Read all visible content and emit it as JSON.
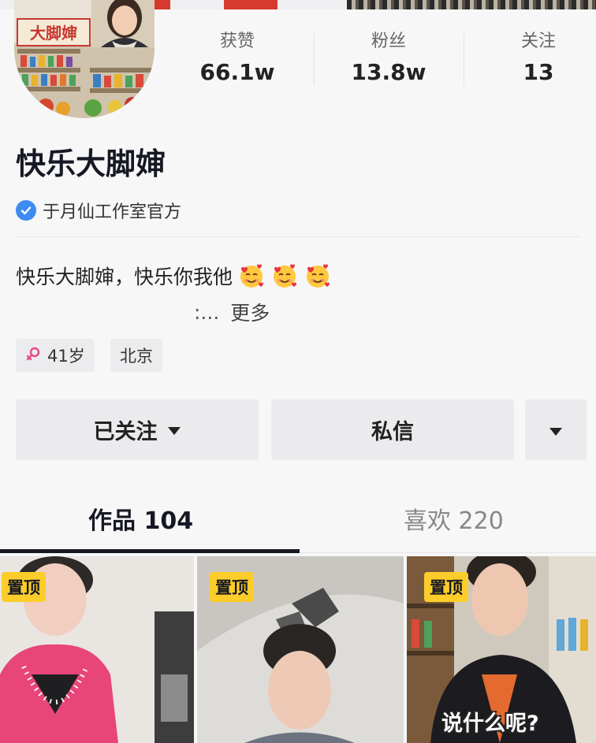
{
  "profile": {
    "name": "快乐大脚婶",
    "avatar_text": "大脚婶",
    "verification": "于月仙工作室官方",
    "stats": [
      {
        "label": "获赞",
        "value": "66.1w"
      },
      {
        "label": "粉丝",
        "value": "13.8w"
      },
      {
        "label": "关注",
        "value": "13"
      }
    ],
    "bio": "快乐大脚婶，快乐你我他",
    "bio_emoji": "smiling-face-with-hearts",
    "bio_tail": ":...",
    "more_label": "更多",
    "tags": [
      {
        "label": "41岁",
        "icon": "female-icon"
      },
      {
        "label": "北京"
      }
    ]
  },
  "actions": {
    "follow_label": "已关注",
    "message_label": "私信"
  },
  "tabs": [
    {
      "label": "作品 104",
      "active": true
    },
    {
      "label": "喜欢 220",
      "active": false
    }
  ],
  "videos": [
    {
      "pin_label": "置顶"
    },
    {
      "pin_label": "置顶"
    },
    {
      "pin_label": "置顶",
      "caption": "说什么呢?"
    }
  ],
  "colors": {
    "verified_badge": "#3d8bf2",
    "pin_badge": "#fccd2a",
    "female_icon": "#e84a8a"
  }
}
